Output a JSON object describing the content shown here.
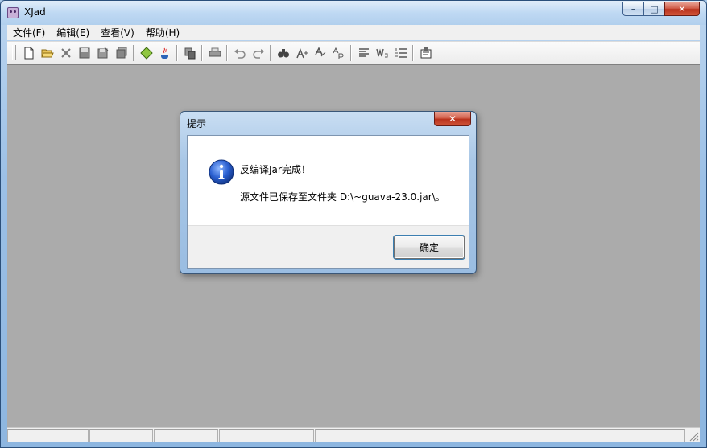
{
  "window": {
    "title": "XJad",
    "minimize_glyph": "–",
    "maximize_glyph": "□",
    "close_glyph": "✕"
  },
  "menu": {
    "items": [
      "文件(F)",
      "编辑(E)",
      "查看(V)",
      "帮助(H)"
    ]
  },
  "toolbar": {
    "groups": [
      [
        "new-file-icon",
        "open-folder-icon",
        "delete-icon",
        "save-icon",
        "save-as-icon",
        "save-all-icon"
      ],
      [
        "decompile-icon",
        "java-icon"
      ],
      [
        "copy-icon"
      ],
      [
        "print-icon"
      ],
      [
        "undo-icon",
        "redo-icon"
      ],
      [
        "find-icon",
        "find-next-icon",
        "replace-icon",
        "replace-all-icon"
      ],
      [
        "align-icon",
        "word-wrap-icon",
        "list-icon"
      ],
      [
        "properties-icon"
      ]
    ]
  },
  "status": {
    "panes": [
      "",
      "",
      "",
      "",
      ""
    ]
  },
  "dialog": {
    "title": "提示",
    "close_glyph": "✕",
    "icon": "info-icon",
    "message_line1": "反编译Jar完成！",
    "message_line2": "源文件已保存至文件夹 D:\\~guava-23.0.jar\\。",
    "ok_label": "确定"
  }
}
